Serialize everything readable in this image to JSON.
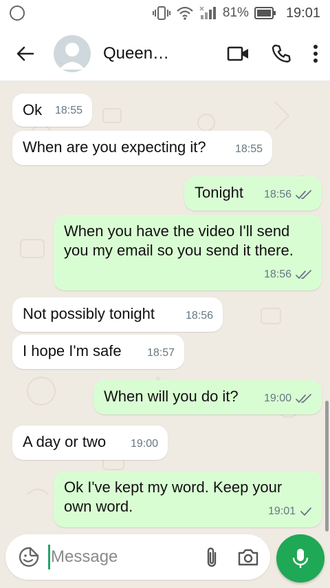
{
  "status_bar": {
    "battery_percent": "81%",
    "time": "19:01",
    "icons": [
      "status-circle-icon",
      "vibrate-icon",
      "wifi-icon",
      "signal-icon",
      "battery-icon"
    ]
  },
  "header": {
    "contact_name": "Queen…",
    "icons": [
      "back-arrow-icon",
      "avatar-icon",
      "video-call-icon",
      "phone-icon",
      "more-vert-icon"
    ]
  },
  "messages": [
    {
      "dir": "in",
      "text": "Ok",
      "time": "18:55"
    },
    {
      "dir": "in",
      "text": "When are you expecting it?",
      "time": "18:55"
    },
    {
      "dir": "out",
      "text": "Tonight",
      "time": "18:56",
      "status": "read"
    },
    {
      "dir": "out",
      "text": "When you have the video I'll send you my email so you send it there.",
      "time": "18:56",
      "status": "read"
    },
    {
      "dir": "in",
      "text": "Not possibly tonight",
      "time": "18:56"
    },
    {
      "dir": "in",
      "text": "I hope I'm safe",
      "time": "18:57"
    },
    {
      "dir": "out",
      "text": "When will you do it?",
      "time": "19:00",
      "status": "read"
    },
    {
      "dir": "in",
      "text": "A day or two",
      "time": "19:00"
    },
    {
      "dir": "out",
      "text": "Ok I've kept my word. Keep your own word.",
      "time": "19:01",
      "status": "sent"
    }
  ],
  "composer": {
    "placeholder": "Message",
    "icons": [
      "sticker-icon",
      "paperclip-icon",
      "camera-icon",
      "mic-icon"
    ]
  },
  "colors": {
    "incoming_bubble": "#ffffff",
    "outgoing_bubble": "#d9fdd3",
    "chat_background": "#efeae2",
    "accent_green": "#1fa855",
    "timestamp": "#667781"
  }
}
